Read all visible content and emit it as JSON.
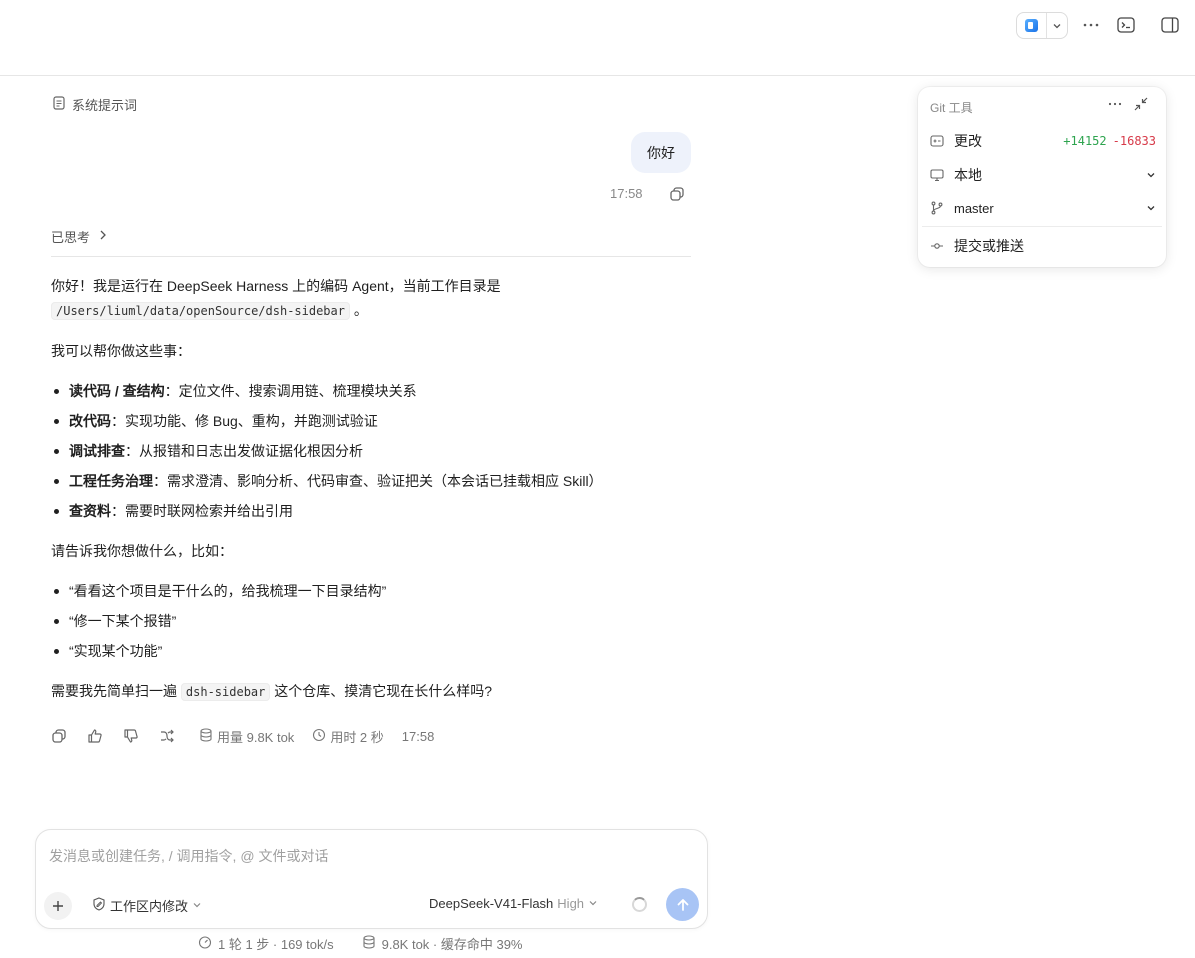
{
  "topbar": {
    "app_icon": "app-switch-icon",
    "more_icon": "more-horizontal-icon",
    "terminal_icon": "terminal-icon",
    "sidebar_icon": "sidebar-right-icon"
  },
  "chat": {
    "system_prompt_label": "系统提示词",
    "user_message": "你好",
    "user_message_time": "17:58",
    "thinking_label": "已思考",
    "answer": {
      "intro_1": "你好！我是运行在 DeepSeek Harness 上的编码 Agent，当前工作目录是",
      "intro_path": "/Users/liuml/data/openSource/dsh-sidebar",
      "intro_end": "。",
      "capabilities_heading": "我可以帮你做这些事：",
      "capabilities": [
        {
          "title": "读代码 / 查结构",
          "desc": "：定位文件、搜索调用链、梳理模块关系"
        },
        {
          "title": "改代码",
          "desc": "：实现功能、修 Bug、重构，并跑测试验证"
        },
        {
          "title": "调试排查",
          "desc": "：从报错和日志出发做证据化根因分析"
        },
        {
          "title": "工程任务治理",
          "desc": "：需求澄清、影响分析、代码审查、验证把关（本会话已挂载相应 Skill）"
        },
        {
          "title": "查资料",
          "desc": "：需要时联网检索并给出引用"
        }
      ],
      "examples_heading": "请告诉我你想做什么，比如：",
      "examples": [
        "“看看这个项目是干什么的，给我梳理一下目录结构”",
        "“修一下某个报错”",
        "“实现某个功能”"
      ],
      "closing_1": "需要我先简单扫一遍",
      "closing_code": "dsh-sidebar",
      "closing_2": "这个仓库、摸清它现在长什么样吗?"
    },
    "actions": {
      "usage": "用量 9.8K tok",
      "duration": "用时 2 秒",
      "time": "17:58"
    }
  },
  "git_panel": {
    "title": "Git 工具",
    "changes_label": "更改",
    "additions": "+14152",
    "deletions": "-16833",
    "location_label": "本地",
    "branch_label": "master",
    "commit_label": "提交或推送"
  },
  "composer": {
    "placeholder": "发消息或创建任务, / 调用指令, @ 文件或对话",
    "scope_label": "工作区内修改",
    "model_name": "DeepSeek-V41-Flash",
    "model_level": "High"
  },
  "footer": {
    "steps": "1 轮 1 步 · 169 tok/s",
    "tokens": "9.8K tok · 缓存命中 39%"
  },
  "colors": {
    "additions": "#2ea44f",
    "deletions": "#d73a49",
    "send_button": "#a8c4f5",
    "user_bubble": "#eef2fb"
  }
}
